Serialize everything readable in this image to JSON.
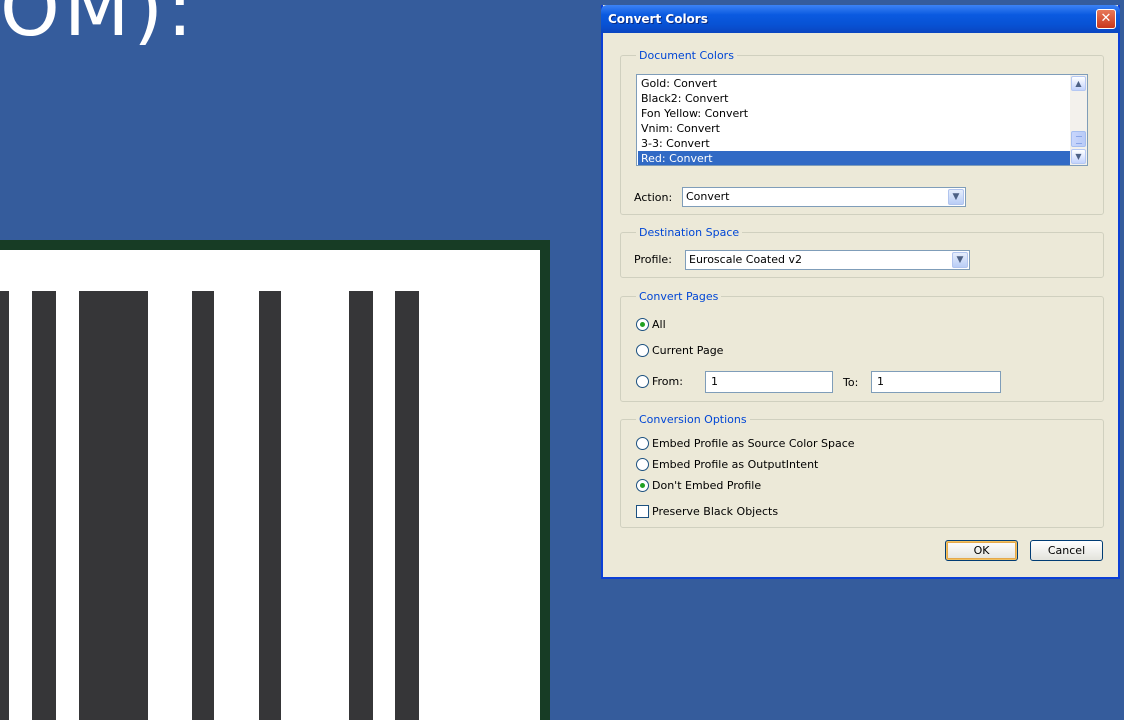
{
  "background": {
    "slide_title": "OM):",
    "colors": {
      "slide_bg": "#355c9c",
      "frame": "#173c25",
      "bar": "#363638"
    }
  },
  "dialog": {
    "title": "Convert Colors",
    "document_colors": {
      "label": "Document Colors",
      "items": [
        {
          "text": "Gold: Convert",
          "selected": false
        },
        {
          "text": "Black2: Convert",
          "selected": false
        },
        {
          "text": "Fon Yellow: Convert",
          "selected": false
        },
        {
          "text": "Vnim: Convert",
          "selected": false
        },
        {
          "text": "3-3: Convert",
          "selected": false
        },
        {
          "text": "Red: Convert",
          "selected": true
        }
      ],
      "action_label": "Action:",
      "action_value": "Convert"
    },
    "destination_space": {
      "label": "Destination Space",
      "profile_label": "Profile:",
      "profile_value": "Euroscale Coated v2"
    },
    "convert_pages": {
      "label": "Convert Pages",
      "all_label": "All",
      "current_label": "Current Page",
      "from_label": "From:",
      "from_value": "1",
      "to_label": "To:",
      "to_value": "1",
      "selected": "all"
    },
    "conversion_options": {
      "label": "Conversion Options",
      "embed_source_label": "Embed Profile as Source Color Space",
      "embed_output_label": "Embed Profile as OutputIntent",
      "dont_embed_label": "Don't Embed Profile",
      "selected": "dont_embed",
      "preserve_black_label": "Preserve Black Objects",
      "preserve_black_checked": false
    },
    "buttons": {
      "ok": "OK",
      "cancel": "Cancel"
    },
    "icons": {
      "close": "close-icon",
      "dropdown": "chevron-down-icon"
    }
  }
}
